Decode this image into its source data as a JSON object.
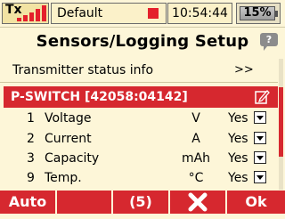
{
  "statusbar": {
    "tx_label": "Tx",
    "signal_level": 5,
    "model_name": "Default",
    "time": "10:54:44",
    "battery": "15%"
  },
  "page": {
    "title": "Sensors/Logging Setup",
    "help_icon_label": "?"
  },
  "transmitter_row": {
    "label": "Transmitter status info",
    "arrow": ">>"
  },
  "device": {
    "label": "P-SWITCH [42058:04142]"
  },
  "sensors": [
    {
      "index": "1",
      "name": "Voltage",
      "unit": "V",
      "value": "Yes"
    },
    {
      "index": "2",
      "name": "Current",
      "unit": "A",
      "value": "Yes"
    },
    {
      "index": "3",
      "name": "Capacity",
      "unit": "mAh",
      "value": "Yes"
    },
    {
      "index": "9",
      "name": "Temp.",
      "unit": "°C",
      "value": "Yes"
    }
  ],
  "bottombar": {
    "auto_label": "Auto",
    "count_label": "(5)",
    "ok_label": "Ok"
  },
  "colors": {
    "accent": "#d6282f",
    "background": "#fdf6d8",
    "signal_red": "#e4202c"
  }
}
